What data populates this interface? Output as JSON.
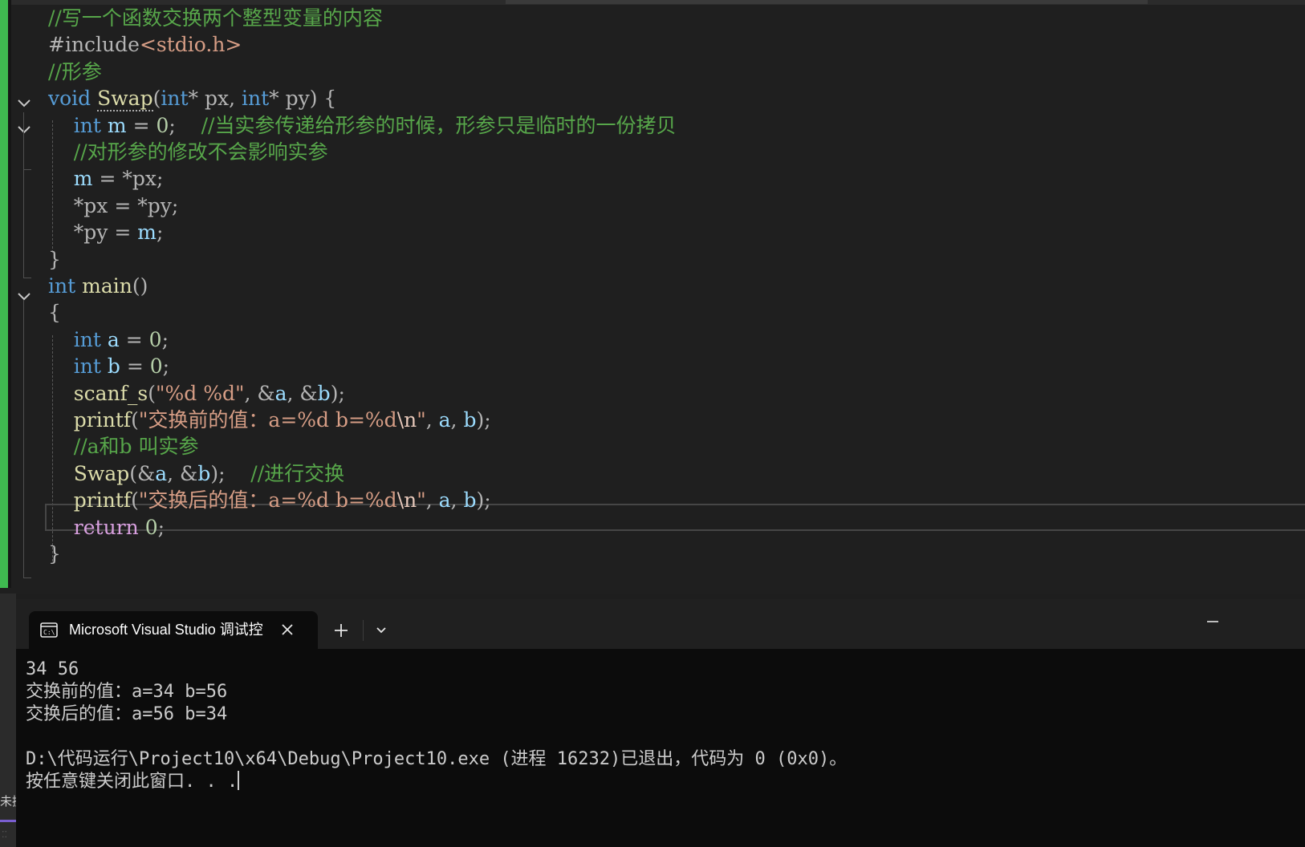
{
  "editor": {
    "lines": [
      [
        {
          "t": "//写一个函数交换两个整型变量的内容",
          "c": "cm"
        }
      ],
      [
        {
          "t": "#include",
          "c": "pn"
        },
        {
          "t": "<stdio.h>",
          "c": "str"
        }
      ],
      [
        {
          "t": "//形参",
          "c": "cm"
        }
      ],
      [
        {
          "t": "void",
          "c": "kw"
        },
        {
          "t": " ",
          "c": "tx"
        },
        {
          "t": "Swap",
          "c": "fn squig"
        },
        {
          "t": "(",
          "c": "pn"
        },
        {
          "t": "int",
          "c": "kw"
        },
        {
          "t": "* ",
          "c": "pn"
        },
        {
          "t": "px",
          "c": "pn"
        },
        {
          "t": ", ",
          "c": "pn"
        },
        {
          "t": "int",
          "c": "kw"
        },
        {
          "t": "* ",
          "c": "pn"
        },
        {
          "t": "py",
          "c": "pn"
        },
        {
          "t": ") {",
          "c": "pn"
        }
      ],
      [
        {
          "t": "    ",
          "c": "tx"
        },
        {
          "t": "int",
          "c": "kw"
        },
        {
          "t": " ",
          "c": "tx"
        },
        {
          "t": "m",
          "c": "var"
        },
        {
          "t": " = ",
          "c": "pn"
        },
        {
          "t": "0",
          "c": "num"
        },
        {
          "t": ";    ",
          "c": "pn"
        },
        {
          "t": "//当实参传递给形参的时候，形参只是临时的一份拷贝",
          "c": "cm"
        }
      ],
      [
        {
          "t": "    ",
          "c": "tx"
        },
        {
          "t": "//对形参的修改不会影响实参",
          "c": "cm"
        }
      ],
      [
        {
          "t": "    ",
          "c": "tx"
        },
        {
          "t": "m",
          "c": "var"
        },
        {
          "t": " = *",
          "c": "pn"
        },
        {
          "t": "px",
          "c": "pn"
        },
        {
          "t": ";",
          "c": "pn"
        }
      ],
      [
        {
          "t": "    ",
          "c": "tx"
        },
        {
          "t": "*",
          "c": "pn"
        },
        {
          "t": "px",
          "c": "pn"
        },
        {
          "t": " = *",
          "c": "pn"
        },
        {
          "t": "py",
          "c": "pn"
        },
        {
          "t": ";",
          "c": "pn"
        }
      ],
      [
        {
          "t": "    ",
          "c": "tx"
        },
        {
          "t": "*",
          "c": "pn"
        },
        {
          "t": "py",
          "c": "pn"
        },
        {
          "t": " = ",
          "c": "pn"
        },
        {
          "t": "m",
          "c": "var"
        },
        {
          "t": ";",
          "c": "pn"
        }
      ],
      [
        {
          "t": "}",
          "c": "pn"
        }
      ],
      [
        {
          "t": "int",
          "c": "kw"
        },
        {
          "t": " ",
          "c": "tx"
        },
        {
          "t": "main",
          "c": "fn"
        },
        {
          "t": "()",
          "c": "pn"
        }
      ],
      [
        {
          "t": "{",
          "c": "pn"
        }
      ],
      [
        {
          "t": "    ",
          "c": "tx"
        },
        {
          "t": "int",
          "c": "kw"
        },
        {
          "t": " ",
          "c": "tx"
        },
        {
          "t": "a",
          "c": "var"
        },
        {
          "t": " = ",
          "c": "pn"
        },
        {
          "t": "0",
          "c": "num"
        },
        {
          "t": ";",
          "c": "pn"
        }
      ],
      [
        {
          "t": "    ",
          "c": "tx"
        },
        {
          "t": "int",
          "c": "kw"
        },
        {
          "t": " ",
          "c": "tx"
        },
        {
          "t": "b",
          "c": "var"
        },
        {
          "t": " = ",
          "c": "pn"
        },
        {
          "t": "0",
          "c": "num"
        },
        {
          "t": ";",
          "c": "pn"
        }
      ],
      [
        {
          "t": "    ",
          "c": "tx"
        },
        {
          "t": "scanf_s",
          "c": "fn"
        },
        {
          "t": "(",
          "c": "pn"
        },
        {
          "t": "\"%d %d\"",
          "c": "str"
        },
        {
          "t": ", &",
          "c": "pn"
        },
        {
          "t": "a",
          "c": "var"
        },
        {
          "t": ", &",
          "c": "pn"
        },
        {
          "t": "b",
          "c": "var"
        },
        {
          "t": ");",
          "c": "pn"
        }
      ],
      [
        {
          "t": "    ",
          "c": "tx"
        },
        {
          "t": "printf",
          "c": "fn"
        },
        {
          "t": "(",
          "c": "pn"
        },
        {
          "t": "\"交换前的值：a=%d b=%d",
          "c": "str"
        },
        {
          "t": "\\n",
          "c": "esc"
        },
        {
          "t": "\"",
          "c": "str"
        },
        {
          "t": ", ",
          "c": "pn"
        },
        {
          "t": "a",
          "c": "var"
        },
        {
          "t": ", ",
          "c": "pn"
        },
        {
          "t": "b",
          "c": "var"
        },
        {
          "t": ");",
          "c": "pn"
        }
      ],
      [
        {
          "t": "    ",
          "c": "tx"
        },
        {
          "t": "//a和b 叫实参",
          "c": "cm"
        }
      ],
      [
        {
          "t": "    ",
          "c": "tx"
        },
        {
          "t": "Swap",
          "c": "fn"
        },
        {
          "t": "(&",
          "c": "pn"
        },
        {
          "t": "a",
          "c": "var"
        },
        {
          "t": ", &",
          "c": "pn"
        },
        {
          "t": "b",
          "c": "var"
        },
        {
          "t": ");    ",
          "c": "pn"
        },
        {
          "t": "//进行交换",
          "c": "cm"
        }
      ],
      [
        {
          "t": "    ",
          "c": "tx"
        },
        {
          "t": "printf",
          "c": "fn"
        },
        {
          "t": "(",
          "c": "pn"
        },
        {
          "t": "\"交换后的值：a=%d b=%d",
          "c": "str"
        },
        {
          "t": "\\n",
          "c": "esc"
        },
        {
          "t": "\"",
          "c": "str"
        },
        {
          "t": ", ",
          "c": "pn"
        },
        {
          "t": "a",
          "c": "var"
        },
        {
          "t": ", ",
          "c": "pn"
        },
        {
          "t": "b",
          "c": "var"
        },
        {
          "t": ");",
          "c": "pn"
        }
      ],
      [
        {
          "t": "    ",
          "c": "tx"
        },
        {
          "t": "return",
          "c": "ctl"
        },
        {
          "t": " ",
          "c": "tx"
        },
        {
          "t": "0",
          "c": "num"
        },
        {
          "t": ";",
          "c": "pn"
        }
      ],
      [
        {
          "t": "}",
          "c": "pn"
        }
      ]
    ]
  },
  "console": {
    "tab_title": "Microsoft Visual Studio 调试控",
    "output": "34 56\n交换前的值：a=34 b=56\n交换后的值：a=56 b=34\n\nD:\\代码运行\\Project10\\x64\\Debug\\Project10.exe (进程 16232)已退出，代码为 0 (0x0)。\n按任意键关闭此窗口. . ."
  },
  "sidebar": {
    "label": "未提"
  },
  "icons": [
    "chevron-down-icon",
    "terminal-icon",
    "close-icon",
    "plus-icon",
    "minimize-icon"
  ],
  "colors": {
    "change_bar": "#3fb950",
    "keyword": "#569cd6",
    "comment": "#57a64a",
    "function": "#dcdcaa",
    "string": "#d69d85"
  }
}
